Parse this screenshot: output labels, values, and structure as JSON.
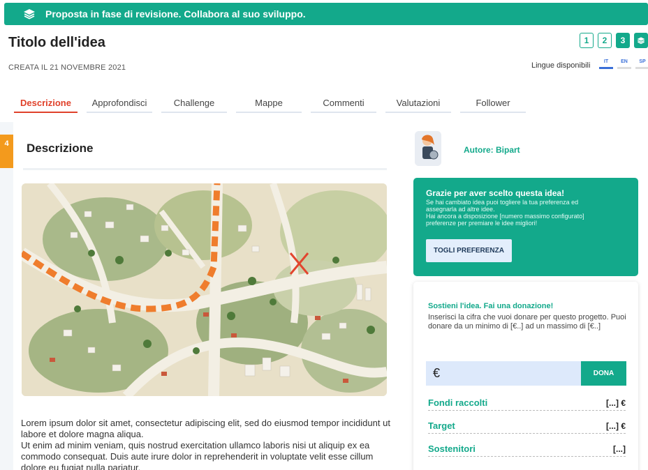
{
  "banner": {
    "icon": "layers-icon",
    "text": "Proposta in fase di revisione. Collabora al suo sviluppo."
  },
  "header": {
    "title": "Titolo dell'idea",
    "created": "CREATA IL 21 NOVEMBRE 2021",
    "phases": [
      "1",
      "2",
      "3"
    ],
    "active_phase": "3",
    "languages_label": "Lingue disponibili",
    "languages": [
      "IT",
      "EN",
      "SP"
    ],
    "active_language": "IT"
  },
  "tabs": [
    "Descrizione",
    "Approfondisci",
    "Challenge",
    "Mappe",
    "Commenti",
    "Valutazioni",
    "Follower"
  ],
  "active_tab": "Descrizione",
  "main": {
    "side_badge": "4",
    "section_title": "Descrizione",
    "image_alt": "city-map-illustration",
    "body": [
      "Lorem ipsum dolor sit amet, consectetur adipiscing elit, sed do eiusmod tempor incididunt ut labore et dolore magna aliqua.",
      "Ut enim ad minim veniam, quis nostrud exercitation ullamco laboris nisi ut aliquip ex ea commodo consequat. Duis aute irure dolor in reprehenderit in voluptate velit esse cillum dolore eu fugiat nulla pariatur."
    ]
  },
  "sidebar": {
    "author": "Autore: Bipart",
    "preference": {
      "title": "Grazie per aver scelto questa idea!",
      "lines": [
        "Se hai cambiato idea puoi togliere la tua preferenza ed",
        "assegnarla ad altre idee.",
        "Hai ancora a disposizione [numero massimo configurato]",
        "preferenze per premiare le idee migliori!"
      ],
      "button": "TOGLI PREFERENZA"
    },
    "donation": {
      "title": "Sostieni l'idea. Fai una donazione!",
      "description": "Inserisci la cifra che vuoi donare per questo progetto. Puoi donare da un minimo di [€..] ad un massimo di [€..]",
      "currency": "€",
      "button": "DONA",
      "stats": [
        {
          "label": "Fondi raccolti",
          "value": "[...] €"
        },
        {
          "label": "Target",
          "value": "[...] €"
        },
        {
          "label": "Sostenitori",
          "value": "[...]"
        }
      ]
    }
  },
  "colors": {
    "accent": "#13a98b",
    "active_tab": "#e0412a",
    "badge": "#f39a1d",
    "language": "#3a6fd8"
  }
}
